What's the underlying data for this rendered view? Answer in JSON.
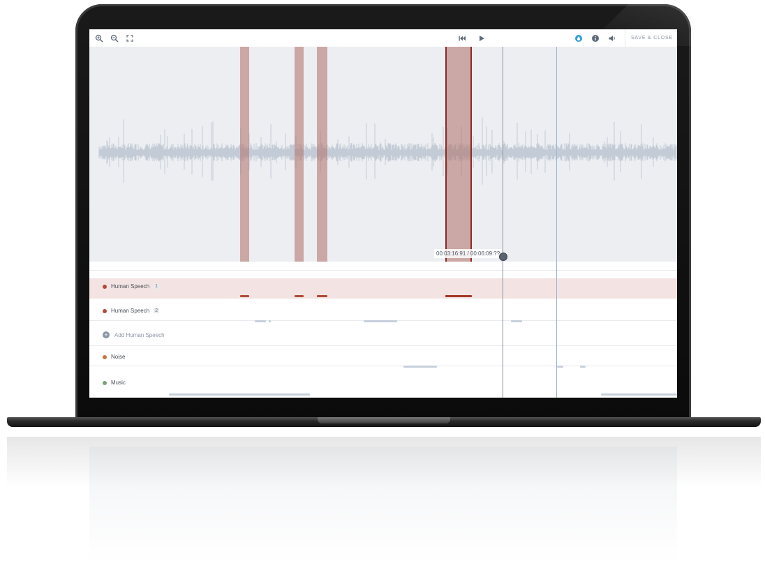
{
  "toolbar": {
    "left_icons": [
      "zoom-in-icon",
      "zoom-out-icon",
      "fullscreen-icon"
    ],
    "center_icons": [
      "skip-back-icon",
      "play-icon"
    ],
    "right_icons": [
      "drop-icon",
      "info-icon",
      "volume-icon"
    ],
    "save_label": "SAVE & CLOSE"
  },
  "playback": {
    "time_label": "00:03:16:91 / 00:06:09:??"
  },
  "tracks": [
    {
      "name": "Human Speech",
      "index": "1",
      "color": "#b24a3b",
      "selected": true
    },
    {
      "name": "Human Speech",
      "index": "2",
      "color": "#b24a3b",
      "selected": false
    },
    {
      "name": "Noise",
      "index": "",
      "color": "#c9763e",
      "selected": false
    },
    {
      "name": "Music",
      "index": "",
      "color": "#7aa07a",
      "selected": false
    }
  ],
  "add_track_label": "Add Human Speech",
  "colors": {
    "segment_fill": "#c48a85",
    "segment_active_border": "#8e2a22",
    "waveform": "#b9c3cf",
    "background": "#eceef2"
  }
}
